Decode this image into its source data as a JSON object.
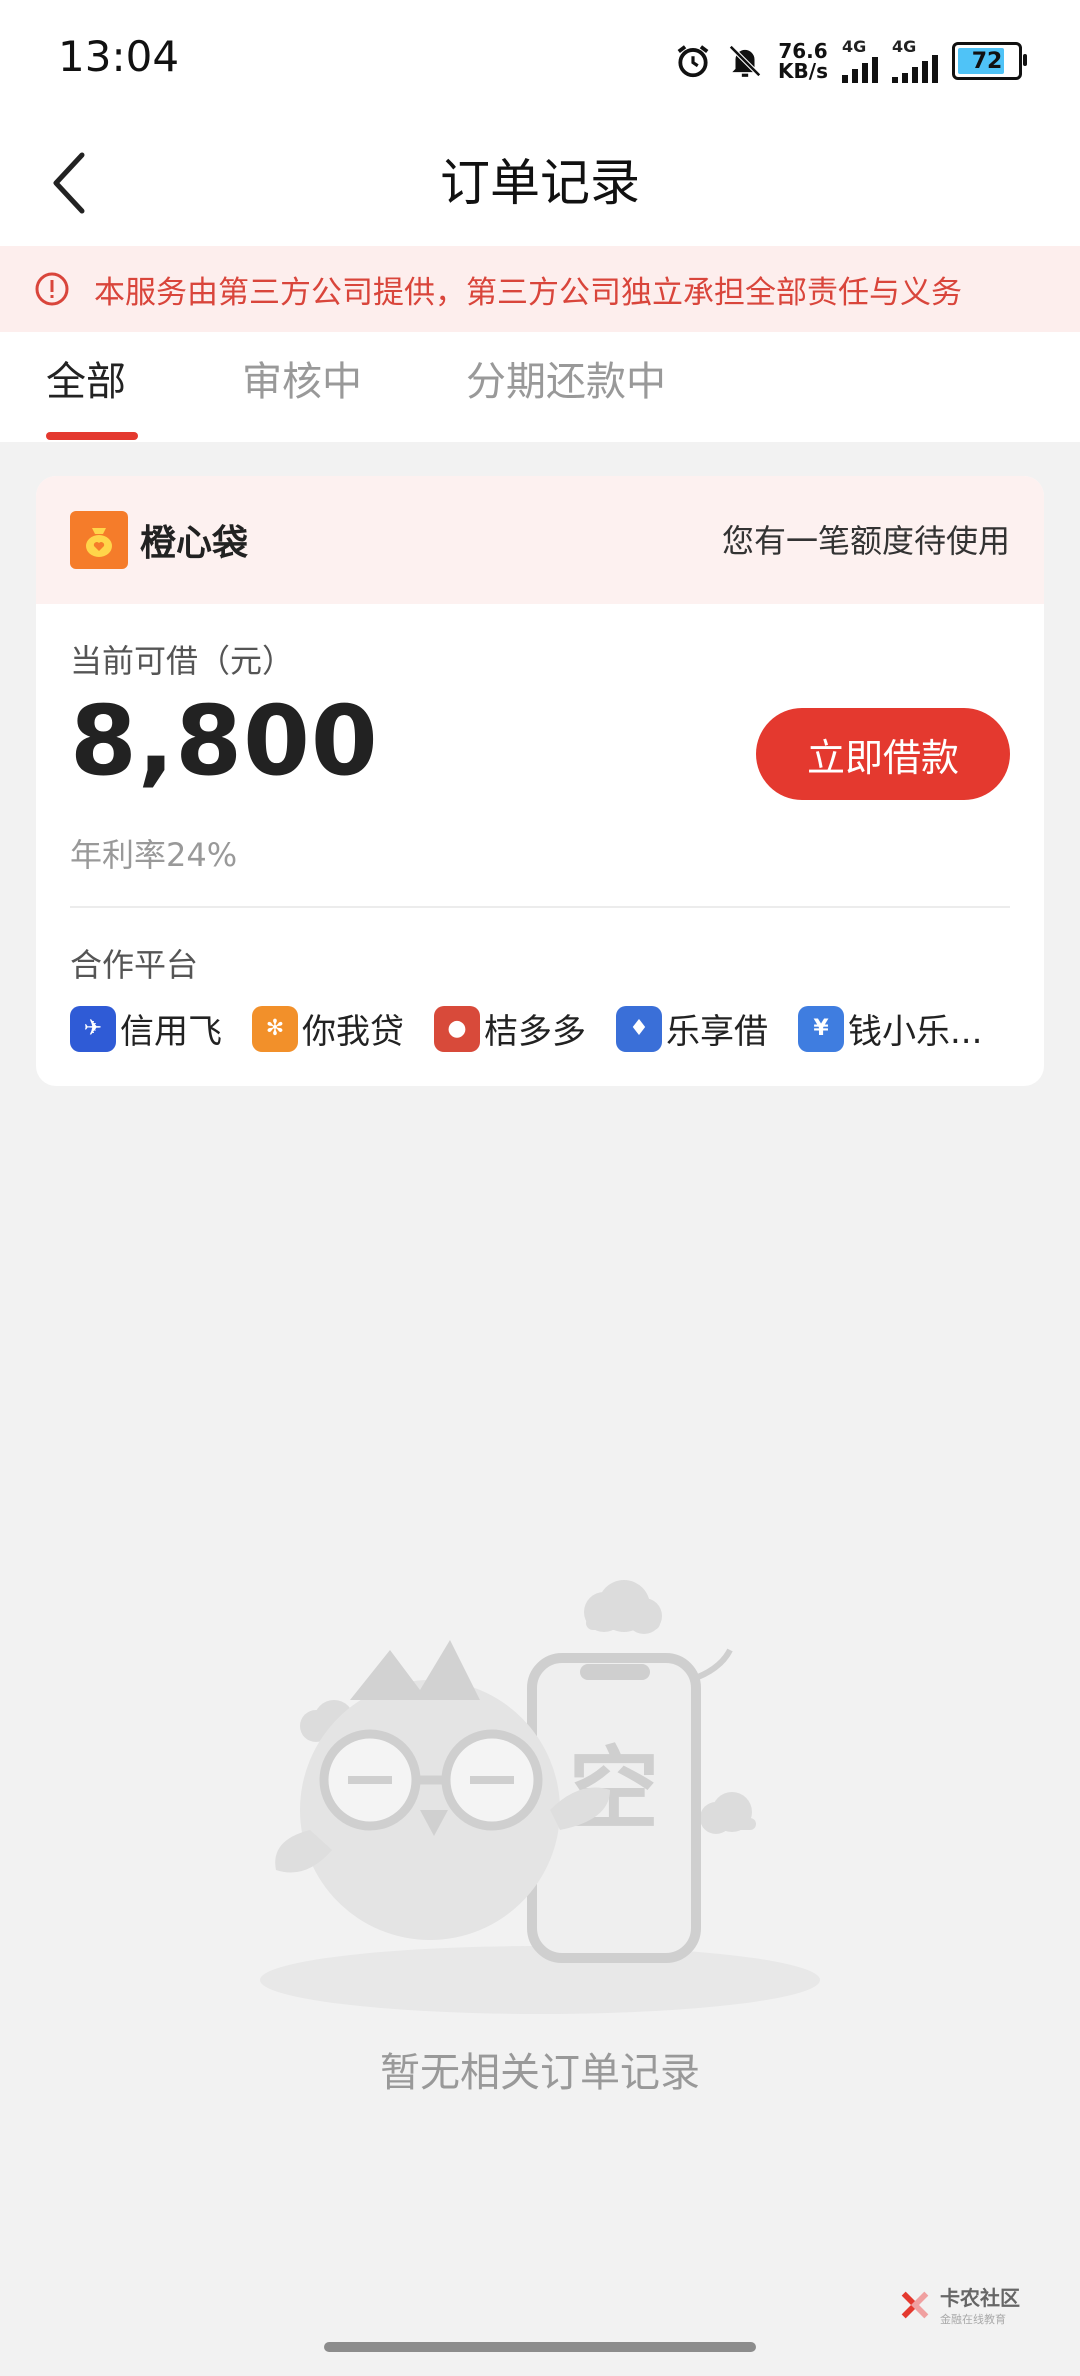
{
  "status_bar": {
    "time": "13:04",
    "net_speed_value": "76.6",
    "net_speed_unit": "KB/s",
    "sim1_label": "4G",
    "sim2_label": "4G",
    "battery_level": "72"
  },
  "header": {
    "title": "订单记录"
  },
  "notice": {
    "text": "本服务由第三方公司提供，第三方公司独立承担全部责任与义务"
  },
  "tabs": [
    {
      "label": "全部",
      "active": true
    },
    {
      "label": "审核中",
      "active": false
    },
    {
      "label": "分期还款中",
      "active": false
    }
  ],
  "card": {
    "brand_name": "橙心袋",
    "hint": "您有一笔额度待使用",
    "available_label": "当前可借（元）",
    "amount": "8,800",
    "borrow_button": "立即借款",
    "rate": "年利率24%",
    "partners_label": "合作平台",
    "partners": [
      {
        "name": "信用飞",
        "icon": "xinyongfei-logo-icon",
        "color": "#2f5bd6"
      },
      {
        "name": "你我贷",
        "icon": "niwodai-logo-icon",
        "color": "#f2902a"
      },
      {
        "name": "桔多多",
        "icon": "juduoduo-logo-icon",
        "color": "#d84a3a"
      },
      {
        "name": "乐享借",
        "icon": "lexiangjie-logo-icon",
        "color": "#3a6fd8"
      },
      {
        "name": "钱小乐...",
        "icon": "qianxiaole-logo-icon",
        "color": "#3f7de0"
      }
    ]
  },
  "empty": {
    "illustration_text": "空",
    "text": "暂无相关订单记录"
  },
  "watermark": {
    "main": "卡农社区",
    "sub": "金融在线教育"
  },
  "colors": {
    "accent": "#e4392f",
    "notice_bg": "#fdeeed",
    "page_bg": "#f2f2f2"
  }
}
